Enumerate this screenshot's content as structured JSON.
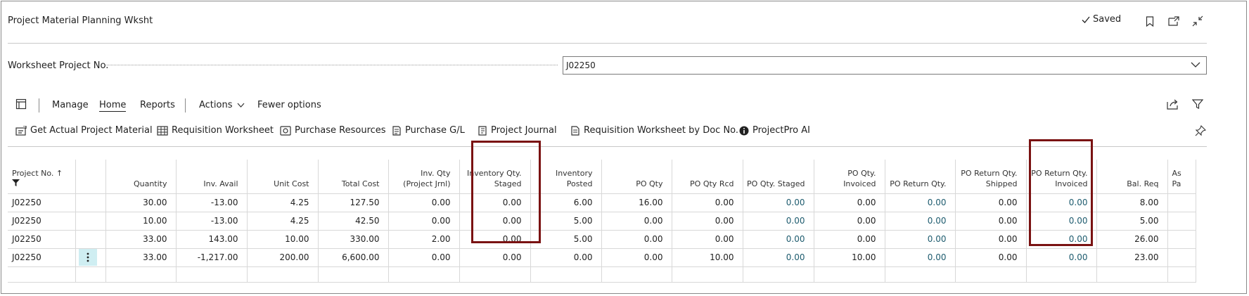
{
  "header": {
    "title": "Project Material Planning Wksht",
    "saved_label": "Saved"
  },
  "field": {
    "label": "Worksheet Project No.",
    "value": "J02250"
  },
  "menu": {
    "manage": "Manage",
    "home": "Home",
    "reports": "Reports",
    "actions": "Actions",
    "fewer": "Fewer options"
  },
  "actions": [
    {
      "label": "Get Actual Project Material",
      "icon": "get-material-icon"
    },
    {
      "label": "Requisition Worksheet",
      "icon": "requisition-worksheet-icon"
    },
    {
      "label": "Purchase Resources",
      "icon": "purchase-resources-icon"
    },
    {
      "label": "Purchase G/L",
      "icon": "purchase-gl-icon"
    },
    {
      "label": "Project Journal",
      "icon": "project-journal-icon"
    },
    {
      "label": "Requisition Worksheet by Doc No.",
      "icon": "document-icon"
    },
    {
      "label": "ProjectPro AI",
      "icon": "info-icon"
    }
  ],
  "grid": {
    "columns": {
      "project_no": "Project No. ↑",
      "quantity": "Quantity",
      "inv_avail": "Inv. Avail",
      "unit_cost": "Unit Cost",
      "total_cost": "Total Cost",
      "inv_qty_project_jrnl": "Inv. Qty (Project Jrnl)",
      "inventory_qty_staged": "Inventory Qty. Staged",
      "inventory_posted": "Inventory Posted",
      "po_qty": "PO Qty",
      "po_qty_rcd": "PO Qty Rcd",
      "po_qty_staged": "PO Qty. Staged",
      "po_qty_invoiced": "PO Qty. Invoiced",
      "po_return_qty": "PO Return Qty.",
      "po_return_qty_shipped": "PO Return Qty. Shipped",
      "po_return_qty_invoiced": "PO Return Qty. Invoiced",
      "bal_req": "Bal. Req",
      "cut_off": "As Pa"
    },
    "rows": [
      {
        "project_no": "J02250",
        "quantity": "30.00",
        "inv_avail": "-13.00",
        "unit_cost": "4.25",
        "total_cost": "127.50",
        "inv_qty_project_jrnl": "0.00",
        "inventory_qty_staged": "0.00",
        "inventory_posted": "6.00",
        "po_qty": "16.00",
        "po_qty_rcd": "0.00",
        "po_qty_staged": "0.00",
        "po_qty_invoiced": "0.00",
        "po_return_qty": "0.00",
        "po_return_qty_shipped": "0.00",
        "po_return_qty_invoiced": "0.00",
        "bal_req": "8.00"
      },
      {
        "project_no": "J02250",
        "quantity": "10.00",
        "inv_avail": "-13.00",
        "unit_cost": "4.25",
        "total_cost": "42.50",
        "inv_qty_project_jrnl": "0.00",
        "inventory_qty_staged": "0.00",
        "inventory_posted": "5.00",
        "po_qty": "0.00",
        "po_qty_rcd": "0.00",
        "po_qty_staged": "0.00",
        "po_qty_invoiced": "0.00",
        "po_return_qty": "0.00",
        "po_return_qty_shipped": "0.00",
        "po_return_qty_invoiced": "0.00",
        "bal_req": "5.00"
      },
      {
        "project_no": "J02250",
        "quantity": "33.00",
        "inv_avail": "143.00",
        "unit_cost": "10.00",
        "total_cost": "330.00",
        "inv_qty_project_jrnl": "2.00",
        "inventory_qty_staged": "0.00",
        "inventory_posted": "5.00",
        "po_qty": "0.00",
        "po_qty_rcd": "0.00",
        "po_qty_staged": "0.00",
        "po_qty_invoiced": "0.00",
        "po_return_qty": "0.00",
        "po_return_qty_shipped": "0.00",
        "po_return_qty_invoiced": "0.00",
        "bal_req": "26.00"
      },
      {
        "project_no": "J02250",
        "quantity": "33.00",
        "inv_avail": "-1,217.00",
        "unit_cost": "200.00",
        "total_cost": "6,600.00",
        "inv_qty_project_jrnl": "0.00",
        "inventory_qty_staged": "0.00",
        "inventory_posted": "0.00",
        "po_qty": "0.00",
        "po_qty_rcd": "10.00",
        "po_qty_staged": "0.00",
        "po_qty_invoiced": "10.00",
        "po_return_qty": "0.00",
        "po_return_qty_shipped": "0.00",
        "po_return_qty_invoiced": "0.00",
        "bal_req": "23.00"
      }
    ]
  },
  "colors": {
    "highlight_box": "#7a1212",
    "teal_value": "#1d5b6e",
    "selected_row_button": "#cfeef2"
  }
}
